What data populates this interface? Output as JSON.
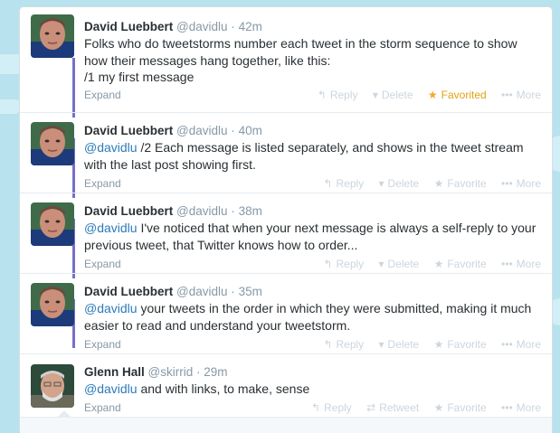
{
  "tweets": [
    {
      "fullname": "David Luebbert",
      "screen_name": "@davidlu",
      "time": "42m",
      "text_parts": [
        "Folks who do tweetstorms number each tweet in the storm sequence to show how their messages hang together, like this:",
        "/1 my first message"
      ],
      "expand": "Expand",
      "actions": {
        "reply": "Reply",
        "delete": "Delete",
        "favorite": "Favorited",
        "more": "More"
      }
    },
    {
      "fullname": "David Luebbert",
      "screen_name": "@davidlu",
      "time": "40m",
      "mention": "@davidlu",
      "text": " /2 Each message is listed separately, and shows in the tweet stream with the last post showing first.",
      "expand": "Expand",
      "actions": {
        "reply": "Reply",
        "delete": "Delete",
        "favorite": "Favorite",
        "more": "More"
      }
    },
    {
      "fullname": "David Luebbert",
      "screen_name": "@davidlu",
      "time": "38m",
      "mention": "@davidlu",
      "text": " I've noticed that when your next message is always a self-reply to your previous tweet, that Twitter knows how to order...",
      "expand": "Expand",
      "actions": {
        "reply": "Reply",
        "delete": "Delete",
        "favorite": "Favorite",
        "more": "More"
      }
    },
    {
      "fullname": "David Luebbert",
      "screen_name": "@davidlu",
      "time": "35m",
      "mention": "@davidlu",
      "text": " your tweets in the order in which they were submitted, making it much easier to read and understand your tweetstorm.",
      "expand": "Expand",
      "actions": {
        "reply": "Reply",
        "delete": "Delete",
        "favorite": "Favorite",
        "more": "More"
      }
    },
    {
      "fullname": "Glenn Hall",
      "screen_name": "@skirrid",
      "time": "29m",
      "mention": "@davidlu",
      "text": " and with links, to make, sense",
      "expand": "Expand",
      "actions": {
        "reply": "Reply",
        "retweet": "Retweet",
        "favorite": "Favorite",
        "more": "More"
      }
    }
  ],
  "separator": "·",
  "icons": {
    "reply": "reply-arrow-icon",
    "delete": "trash-icon",
    "retweet": "retweet-icon",
    "favorite": "star-icon",
    "more": "more-dots-icon"
  },
  "colors": {
    "background": "#b7e2ee",
    "connector": "#7670cf",
    "link": "#2b7bb9",
    "favorited": "#f5a623",
    "muted": "#8899a6"
  }
}
